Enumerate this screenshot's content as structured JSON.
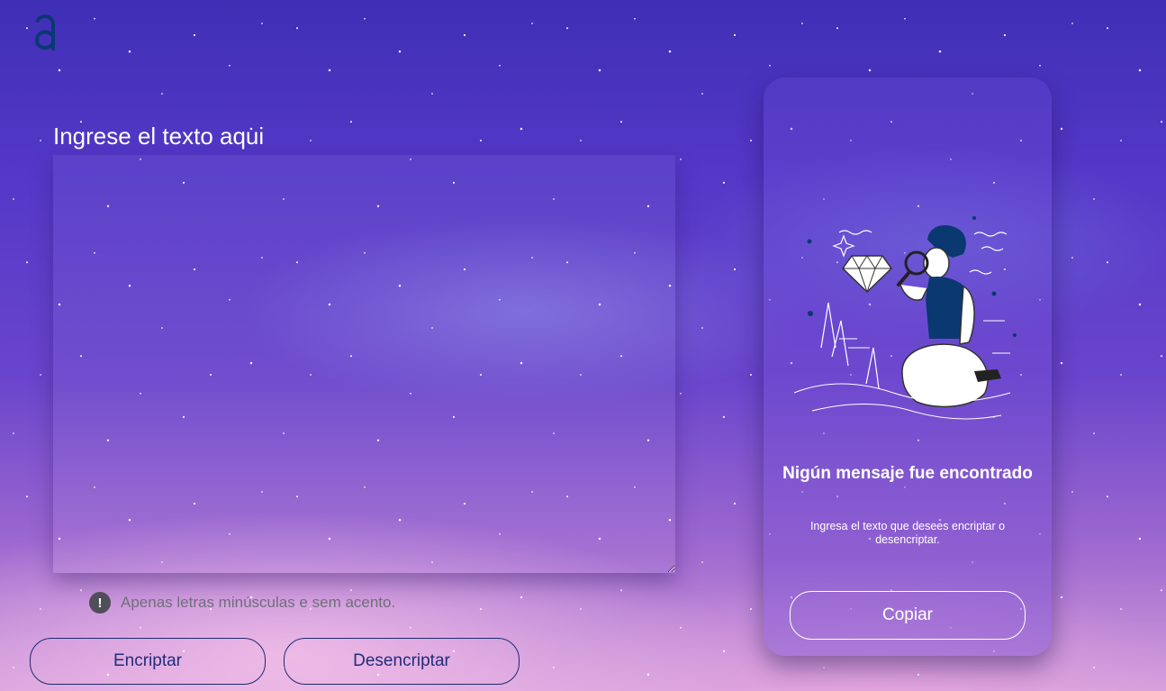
{
  "header": {
    "logo_icon": "alura-logo-icon"
  },
  "input_section": {
    "placeholder": "Ingrese el texto aqui",
    "warning_icon": "exclamation-circle-icon",
    "warning_text": "Apenas letras minúsculas e sem acento."
  },
  "actions": {
    "encrypt_label": "Encriptar",
    "decrypt_label": "Desencriptar"
  },
  "output_panel": {
    "illustration": "person-with-magnifier-illustration",
    "title": "Nigún mensaje fue encontrado",
    "subtitle": "Ingresa el texto que desees encriptar o desencriptar.",
    "copy_label": "Copiar"
  },
  "colors": {
    "accent_dark_blue": "#0a3871",
    "button_text": "#222d7a",
    "warning_gray": "#4f4f57"
  }
}
